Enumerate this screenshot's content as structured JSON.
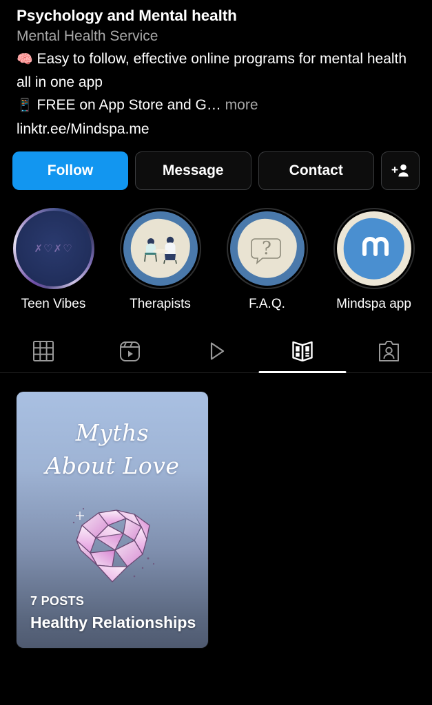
{
  "profile": {
    "display_name": "Psychology and Mental health",
    "category": "Mental Health Service",
    "bio_line1_emoji": "🧠",
    "bio_line1": " Easy to follow, effective online programs for mental health all in one app",
    "bio_line2_emoji": "📱",
    "bio_line2": " FREE on App Store and G…",
    "more_label": " more",
    "link": "linktr.ee/Mindspa.me"
  },
  "actions": {
    "follow_label": "Follow",
    "message_label": "Message",
    "contact_label": "Contact",
    "add_person_icon": "add-person-icon",
    "follow_color": "#1296f0"
  },
  "highlights": [
    {
      "label": "Teen Vibes",
      "cover": "xoxo-pattern",
      "has_unseen_ring": true
    },
    {
      "label": "Therapists",
      "cover": "two-people-illustration",
      "has_unseen_ring": false
    },
    {
      "label": "F.A.Q.",
      "cover": "question-speech-bubble",
      "has_unseen_ring": false
    },
    {
      "label": "Mindspa app",
      "cover": "mindspa-logo",
      "has_unseen_ring": false
    }
  ],
  "tabs": [
    {
      "name": "grid-tab",
      "icon": "grid-icon",
      "active": false
    },
    {
      "name": "reels-tab",
      "icon": "reels-icon",
      "active": false
    },
    {
      "name": "video-tab",
      "icon": "play-icon",
      "active": false
    },
    {
      "name": "guides-tab",
      "icon": "book-icon",
      "active": true
    },
    {
      "name": "tagged-tab",
      "icon": "tagged-person-icon",
      "active": false
    }
  ],
  "guides": [
    {
      "cover_title_line1": "Myths",
      "cover_title_line2": "About Love",
      "cover_art": "crystal-heart",
      "posts_label": "7 POSTS",
      "name": "Healthy Relationships",
      "gradient_top": "#a9c0e2",
      "gradient_bottom": "#4f5a70"
    }
  ]
}
